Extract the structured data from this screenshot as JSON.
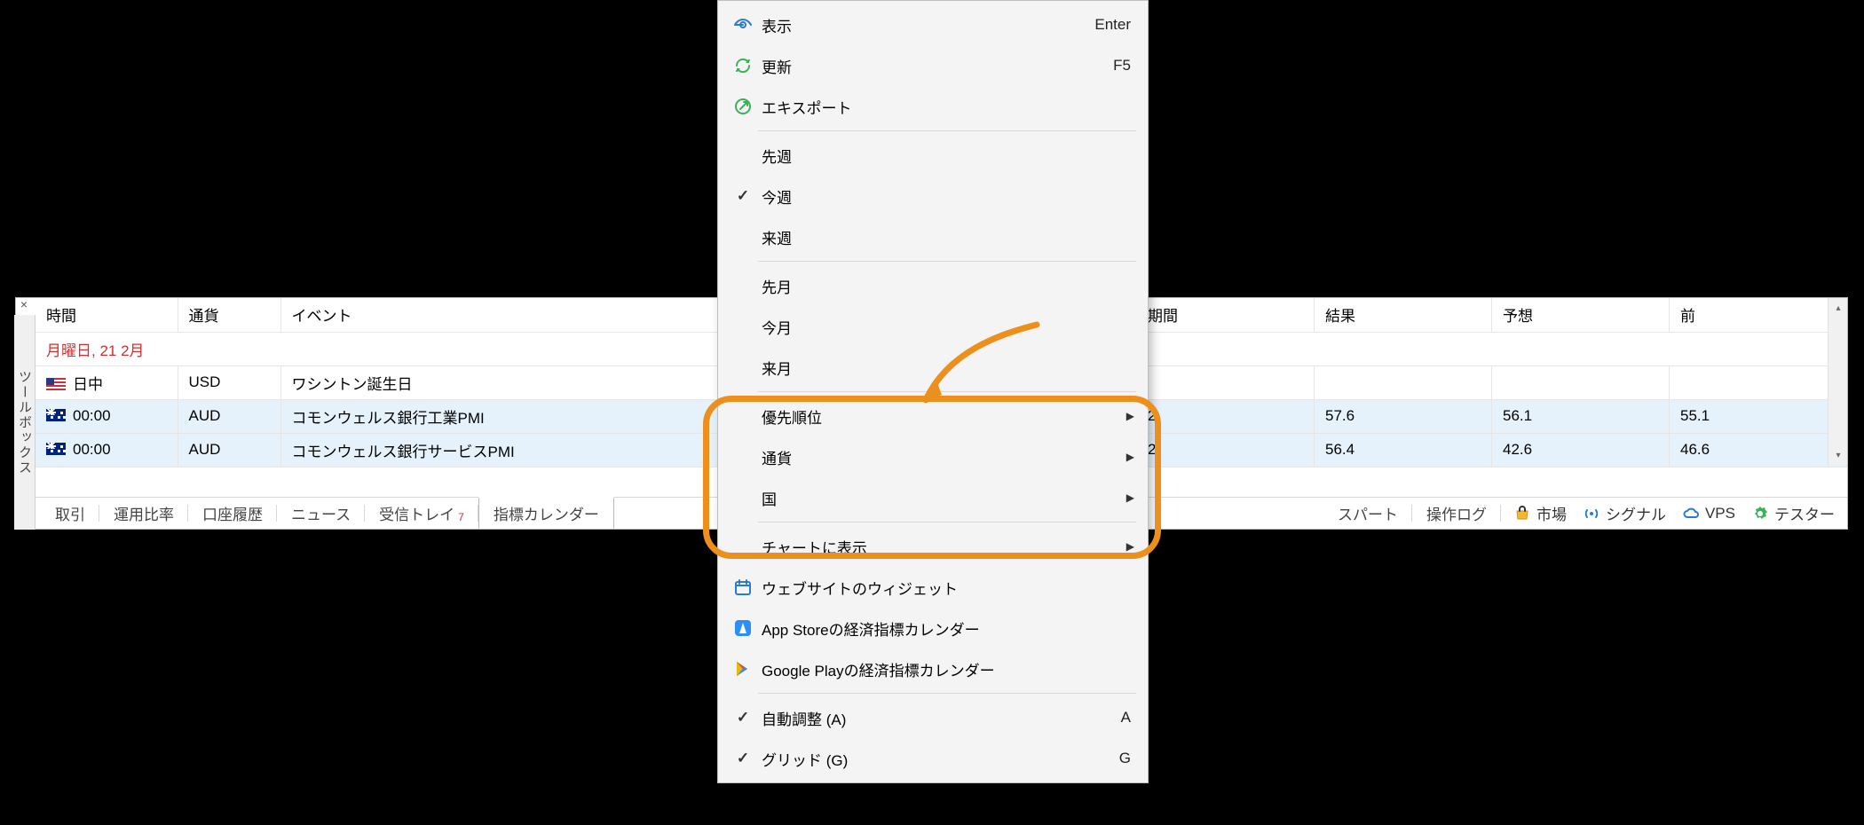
{
  "toolbox": {
    "title": "ツールボックス",
    "close": "×"
  },
  "table": {
    "headers": {
      "time": "時間",
      "currency": "通貨",
      "event": "イベント",
      "period": "期間",
      "result": "結果",
      "forecast": "予想",
      "previous": "前"
    },
    "date_row": "月曜日, 21 2月",
    "rows": [
      {
        "time": "日中",
        "currency": "USD",
        "event": "ワシントン誕生日",
        "period": "",
        "result": "",
        "forecast": "",
        "previous": "",
        "flag": "us",
        "selected": false
      },
      {
        "time": "00:00",
        "currency": "AUD",
        "event": "コモンウェルス銀行工業PMI",
        "period": "2",
        "result": "57.6",
        "forecast": "56.1",
        "previous": "55.1",
        "flag": "au",
        "selected": true
      },
      {
        "time": "00:00",
        "currency": "AUD",
        "event": "コモンウェルス銀行サービスPMI",
        "period": "2",
        "result": "56.4",
        "forecast": "42.6",
        "previous": "46.6",
        "flag": "au",
        "selected": true
      }
    ]
  },
  "tabs": {
    "items": [
      {
        "label": "取引"
      },
      {
        "label": "運用比率"
      },
      {
        "label": "口座履歴"
      },
      {
        "label": "ニュース"
      },
      {
        "label": "受信トレイ",
        "badge": "7"
      },
      {
        "label": "指標カレンダー",
        "active": true
      },
      {
        "label": "..."
      },
      {
        "label": "スパート"
      },
      {
        "label": "操作ログ"
      }
    ],
    "tools": {
      "market": "市場",
      "signal": "シグナル",
      "vps": "VPS",
      "tester": "テスター"
    }
  },
  "menu": {
    "view": {
      "label": "表示",
      "hotkey": "Enter"
    },
    "refresh": {
      "label": "更新",
      "hotkey": "F5"
    },
    "export": {
      "label": "エキスポート"
    },
    "prev_week": "先週",
    "this_week": "今週",
    "next_week": "来週",
    "prev_month": "先月",
    "this_month": "今月",
    "next_month": "来月",
    "priority": "優先順位",
    "currency": "通貨",
    "country": "国",
    "show_on_chart": "チャートに表示",
    "widget": "ウェブサイトのウィジェット",
    "appstore": "App Storeの経済指標カレンダー",
    "play": "Google Playの経済指標カレンダー",
    "autofit": {
      "label": "自動調整 (A)",
      "hotkey": "A"
    },
    "grid": {
      "label": "グリッド (G)",
      "hotkey": "G"
    }
  }
}
